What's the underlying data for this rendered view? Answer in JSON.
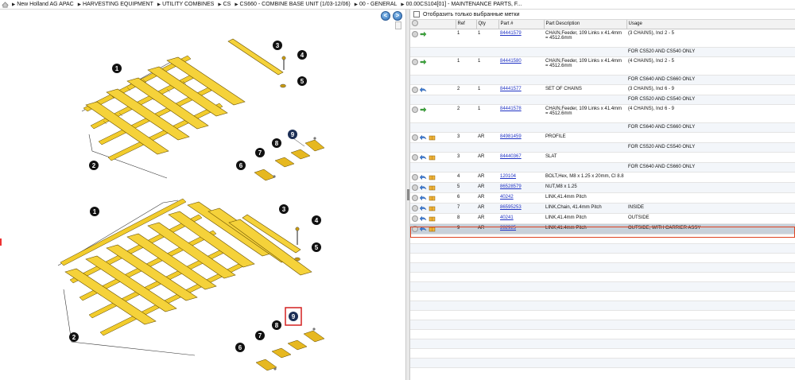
{
  "breadcrumb": [
    "New Holland AG APAC",
    "HARVESTING EQUIPMENT",
    "UTILITY COMBINES",
    "CS",
    "CS660 - COMBINE BASE UNIT (1/03-12/06)",
    "00 - GENERAL",
    "00.00CS104[01] - MAINTENANCE PARTS, F..."
  ],
  "nav": {
    "back": "<",
    "forward": ">"
  },
  "filter": {
    "label": "Отобразить только выбранные метки"
  },
  "columns": {
    "ref": "Ref",
    "qty": "Qty",
    "part": "Part #",
    "desc": "Part Description",
    "usage": "Usage"
  },
  "rows": [
    {
      "ref": "1",
      "qty": "1",
      "part": "84441579",
      "desc": "CHAIN,Feeder, 109 Links x 41.4mm = 4512.6mm",
      "usage": "(3 CHAINS), Incl 2 - 5",
      "icon": "green-arrow"
    },
    {
      "note": "FOR CS520 AND CS540 ONLY"
    },
    {
      "ref": "1",
      "qty": "1",
      "part": "84441580",
      "desc": "CHAIN,Feeder, 109 Links x 41.4mm = 4512.6mm",
      "usage": "(4 CHAINS), Incl 2 - 5",
      "icon": "green-arrow"
    },
    {
      "note": "FOR CS640 AND CS660 ONLY"
    },
    {
      "ref": "2",
      "qty": "1",
      "part": "84441577",
      "desc": "SET OF CHAINS",
      "usage": "(3 CHAINS), Incl 6 - 9",
      "icon": "blue-arrow"
    },
    {
      "note": "FOR CS520 AND CS540 ONLY"
    },
    {
      "ref": "2",
      "qty": "1",
      "part": "84441578",
      "desc": "CHAIN,Feeder, 109 Links x 41.4mm = 4512.6mm",
      "usage": "(4 CHAINS), Incl 6 - 9",
      "icon": "green-arrow"
    },
    {
      "note": "FOR CS640 AND CS660 ONLY"
    },
    {
      "ref": "3",
      "qty": "AR",
      "part": "84981459",
      "desc": "PROFILE",
      "usage": "",
      "icon": "blue-arrow-box"
    },
    {
      "note": "FOR CS520 AND CS540 ONLY"
    },
    {
      "ref": "3",
      "qty": "AR",
      "part": "84440367",
      "desc": "SLAT",
      "usage": "",
      "icon": "blue-arrow-box"
    },
    {
      "note": "FOR CS640 AND CS660 ONLY"
    },
    {
      "ref": "4",
      "qty": "AR",
      "part": "120104",
      "desc": "BOLT,Hex, M8 x 1.25 x 20mm, Cl 8.8",
      "usage": "",
      "icon": "blue-arrow-box"
    },
    {
      "ref": "5",
      "qty": "AR",
      "part": "86528579",
      "desc": "NUT,M8 x 1.25",
      "usage": "",
      "icon": "blue-arrow-box"
    },
    {
      "ref": "6",
      "qty": "AR",
      "part": "40242",
      "desc": "LINK,41.4mm Pitch",
      "usage": "",
      "icon": "blue-arrow-box"
    },
    {
      "ref": "7",
      "qty": "AR",
      "part": "86595253",
      "desc": "LINK,Chain, 41.4mm Pitch",
      "usage": "INSIDE",
      "icon": "blue-arrow-box"
    },
    {
      "ref": "8",
      "qty": "AR",
      "part": "40241",
      "desc": "LINK,41.4mm Pitch",
      "usage": "OUTSIDE",
      "icon": "blue-arrow-box"
    },
    {
      "ref": "9",
      "qty": "AR",
      "part": "282925",
      "desc": "LINK,41.4mm Pitch",
      "usage": "OUTSIDE, WITH CARRIER ASSY",
      "icon": "blue-arrow-box",
      "selected": true
    }
  ],
  "diagram": {
    "top_callouts": [
      "1",
      "2",
      "3",
      "4",
      "5",
      "6",
      "7",
      "8",
      "9"
    ],
    "bottom_callouts": [
      "1",
      "2",
      "3",
      "4",
      "5",
      "6",
      "7",
      "8",
      "9"
    ],
    "highlight_color": "#d42020",
    "part_color": "#f2cc2c"
  }
}
